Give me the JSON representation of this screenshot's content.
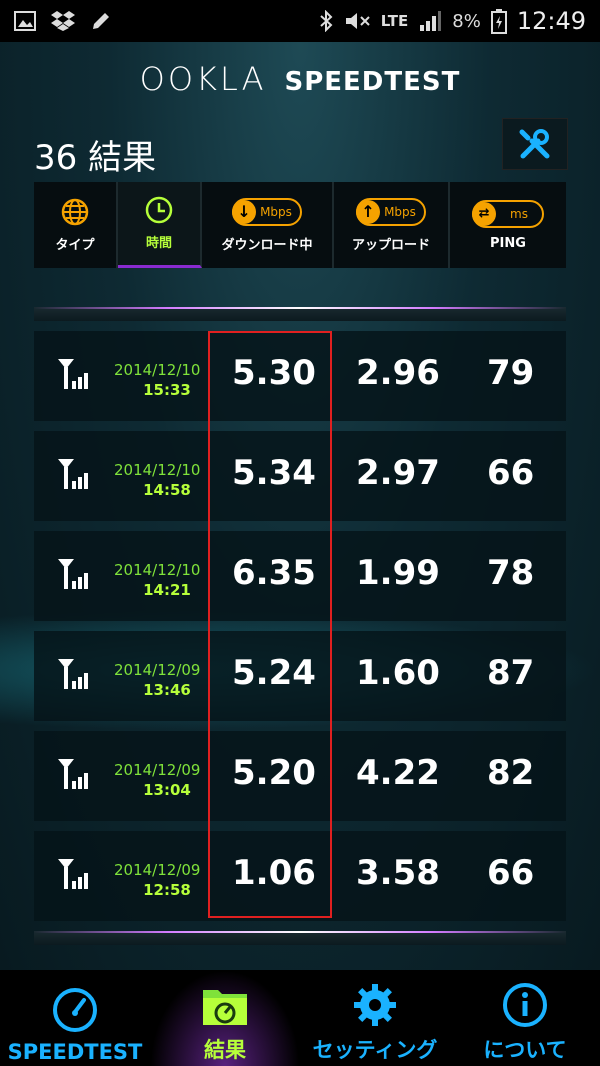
{
  "status_bar": {
    "network": "LTE",
    "battery": "8%",
    "time": "12:49",
    "icons": [
      "gallery-icon",
      "dropbox-icon",
      "edit-icon",
      "bluetooth-icon",
      "mute-icon",
      "signal-icon",
      "battery-icon"
    ]
  },
  "header": {
    "brand_ookla": "OOKLA",
    "brand_speedtest": "SPEEDTEST"
  },
  "results_title": "36 結果",
  "sort_tabs": [
    {
      "label": "タイプ",
      "icon": "globe-icon"
    },
    {
      "label": "時間",
      "icon": "clock-icon",
      "active": true
    },
    {
      "label": "ダウンロード中",
      "unit": "Mbps",
      "icon": "download-icon"
    },
    {
      "label": "アップロード",
      "unit": "Mbps",
      "icon": "upload-icon"
    },
    {
      "label": "PING",
      "unit": "ms",
      "icon": "ping-icon"
    }
  ],
  "rows": [
    {
      "date": "2014/12/10",
      "time": "15:33",
      "download": "5.30",
      "upload": "2.96",
      "ping": "79"
    },
    {
      "date": "2014/12/10",
      "time": "14:58",
      "download": "5.34",
      "upload": "2.97",
      "ping": "66"
    },
    {
      "date": "2014/12/10",
      "time": "14:21",
      "download": "6.35",
      "upload": "1.99",
      "ping": "78"
    },
    {
      "date": "2014/12/09",
      "time": "13:46",
      "download": "5.24",
      "upload": "1.60",
      "ping": "87"
    },
    {
      "date": "2014/12/09",
      "time": "13:04",
      "download": "5.20",
      "upload": "4.22",
      "ping": "82"
    },
    {
      "date": "2014/12/09",
      "time": "12:58",
      "download": "1.06",
      "upload": "3.58",
      "ping": "66"
    }
  ],
  "bottom_nav": [
    {
      "label": "SPEEDTEST",
      "icon": "speedometer-icon"
    },
    {
      "label": "結果",
      "icon": "results-folder-icon",
      "active": true
    },
    {
      "label": "セッティング",
      "icon": "gear-icon"
    },
    {
      "label": "について",
      "icon": "info-icon"
    }
  ],
  "colors": {
    "accent_green": "#b6ff3a",
    "accent_orange": "#f5a200",
    "accent_blue": "#1ab2ff",
    "highlight_red": "#e02020"
  }
}
